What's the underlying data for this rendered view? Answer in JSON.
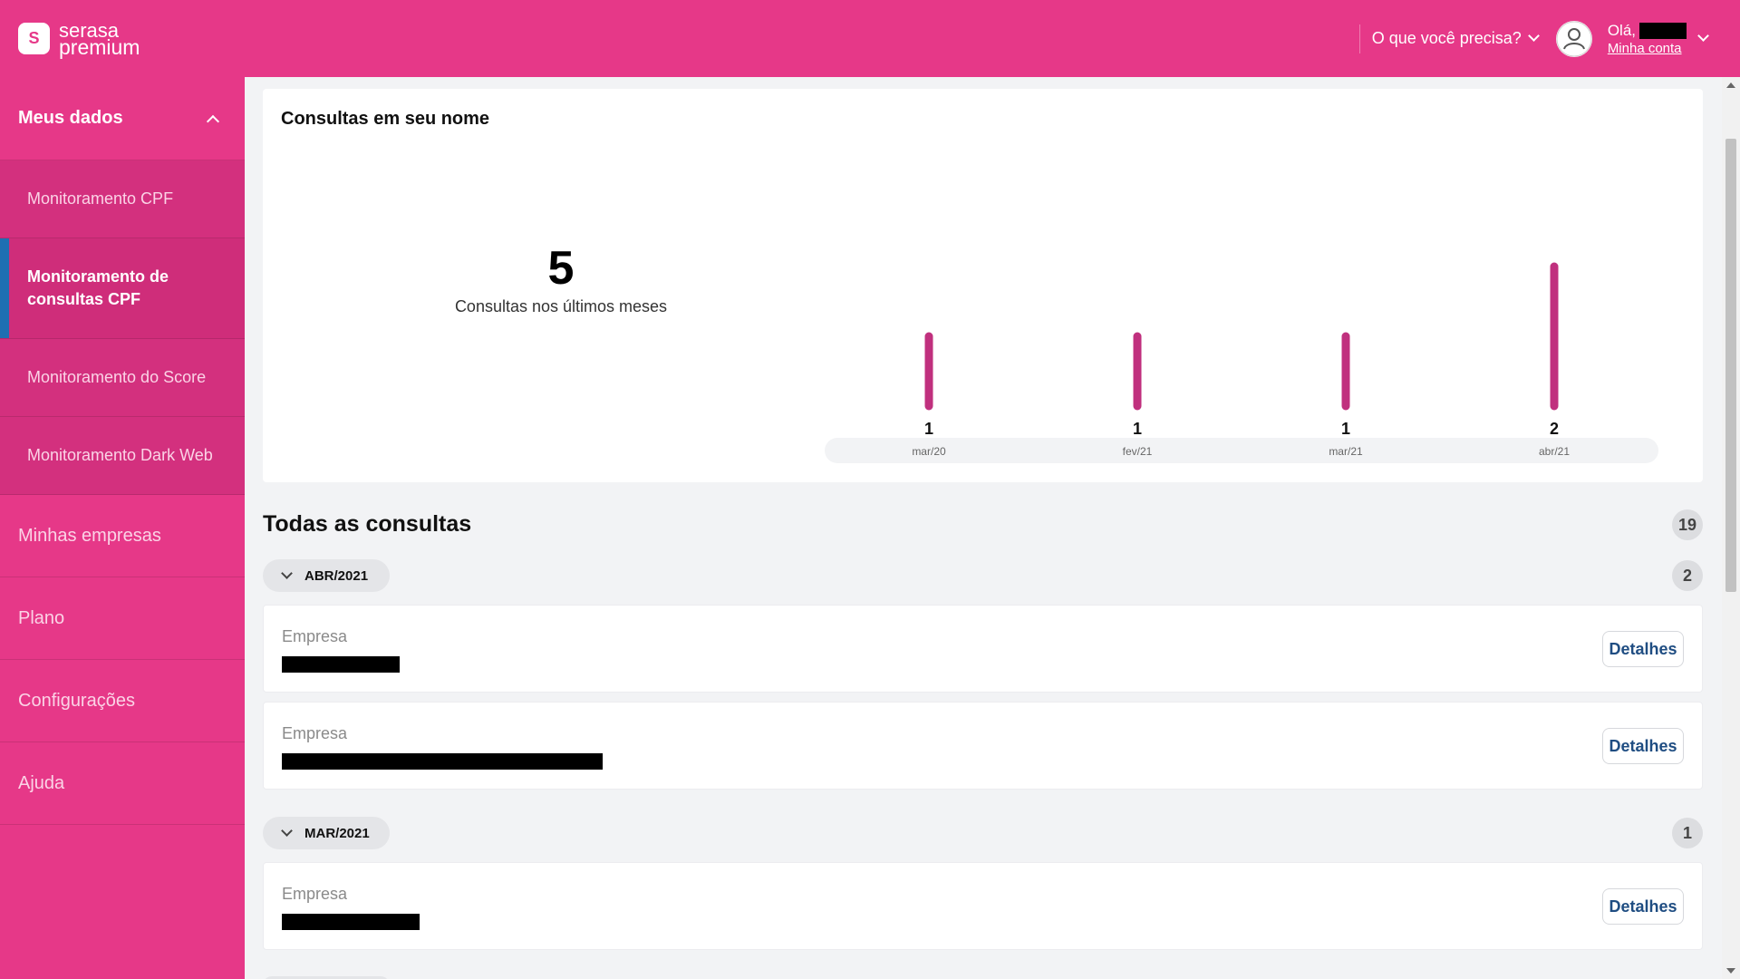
{
  "header": {
    "logo_line1": "serasa",
    "logo_line2": "premium",
    "need_label": "O que você precisa?",
    "greeting": "Olá,",
    "account_link": "Minha conta"
  },
  "sidebar": {
    "section": "Meus dados",
    "sub_items": [
      "Monitoramento CPF",
      "Monitoramento de consultas CPF",
      "Monitoramento do Score",
      "Monitoramento Dark Web"
    ],
    "items": [
      "Minhas empresas",
      "Plano",
      "Configurações",
      "Ajuda"
    ]
  },
  "summary": {
    "title": "Consultas em seu nome",
    "total": "5",
    "total_label": "Consultas nos últimos meses"
  },
  "chart_data": {
    "type": "bar",
    "categories": [
      "mar/20",
      "fev/21",
      "mar/21",
      "abr/21"
    ],
    "values": [
      1,
      1,
      1,
      2
    ],
    "title": "",
    "xlabel": "",
    "ylabel": "",
    "ylim": [
      0,
      2
    ],
    "color": "#c0307e"
  },
  "all": {
    "title": "Todas as consultas",
    "count": "19",
    "groups": [
      {
        "month": "ABR/2021",
        "count": "2"
      },
      {
        "month": "MAR/2021",
        "count": "1"
      }
    ],
    "row_label": "Empresa",
    "details_label": "Detalhes"
  }
}
